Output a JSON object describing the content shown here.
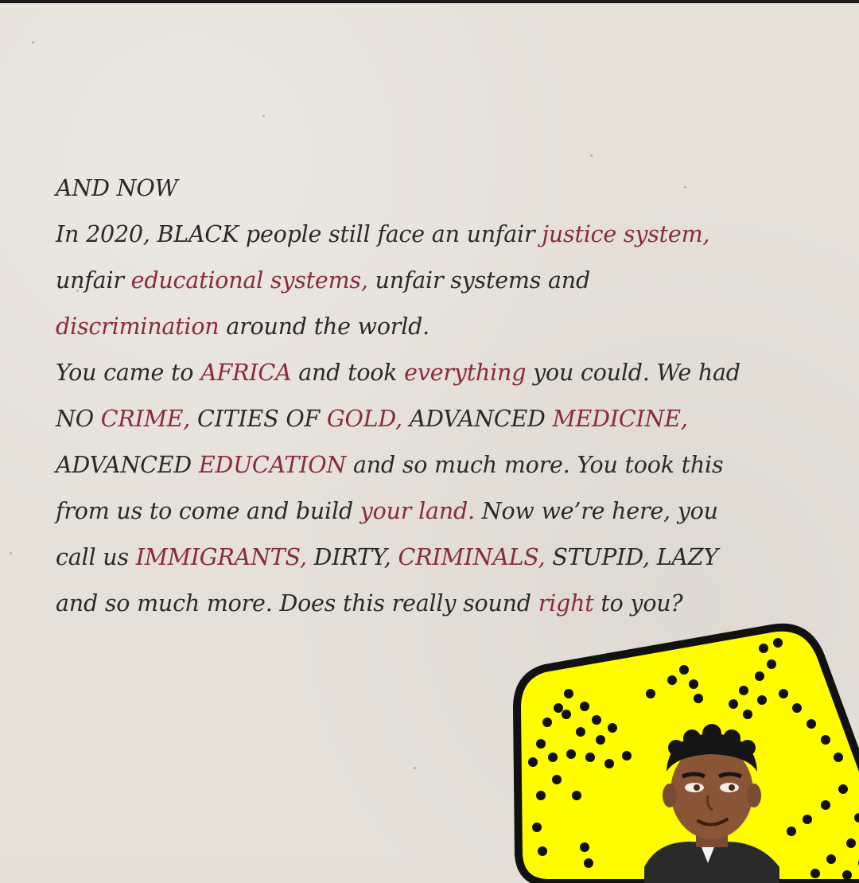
{
  "lines": [
    [
      {
        "t": "AND NOW",
        "h": false
      }
    ],
    [
      {
        "t": "In 2020, BLACK people still face an unfair ",
        "h": false
      },
      {
        "t": "justice system,",
        "h": true
      }
    ],
    [
      {
        "t": "unfair ",
        "h": false
      },
      {
        "t": "educational systems,",
        "h": true
      },
      {
        "t": " unfair systems and",
        "h": false
      }
    ],
    [
      {
        "t": "discrimination",
        "h": true
      },
      {
        "t": " around the world.",
        "h": false
      }
    ],
    [
      {
        "t": "You came to ",
        "h": false
      },
      {
        "t": "AFRICA",
        "h": true
      },
      {
        "t": " and took ",
        "h": false
      },
      {
        "t": "everything",
        "h": true
      },
      {
        "t": " you could. We had",
        "h": false
      }
    ],
    [
      {
        "t": "NO ",
        "h": false
      },
      {
        "t": "CRIME,",
        "h": true
      },
      {
        "t": " CITIES OF ",
        "h": false
      },
      {
        "t": "GOLD,",
        "h": true
      },
      {
        "t": " ADVANCED ",
        "h": false
      },
      {
        "t": "MEDICINE,",
        "h": true
      }
    ],
    [
      {
        "t": "ADVANCED ",
        "h": false
      },
      {
        "t": "EDUCATION",
        "h": true
      },
      {
        "t": " and so much more. You took this",
        "h": false
      }
    ],
    [
      {
        "t": "from us to come and build ",
        "h": false
      },
      {
        "t": "your land.",
        "h": true
      },
      {
        "t": " Now we’re here, you",
        "h": false
      }
    ],
    [
      {
        "t": "call us ",
        "h": false
      },
      {
        "t": "IMMIGRANTS,",
        "h": true
      },
      {
        "t": " DIRTY, ",
        "h": false
      },
      {
        "t": "CRIMINALS,",
        "h": true
      },
      {
        "t": " STUPID, LAZY",
        "h": false
      }
    ],
    [
      {
        "t": "and so much more.   Does this really sound ",
        "h": false
      },
      {
        "t": "right",
        "h": true
      },
      {
        "t": " to you?",
        "h": false
      }
    ]
  ],
  "colors": {
    "text": "#2b2a2a",
    "highlight": "#8a2a3a",
    "paper": "#e5e1d9",
    "snapcode_yellow": "#fffc00"
  },
  "icons": {
    "snapcode": "snapcode-icon",
    "avatar": "bitmoji-avatar"
  }
}
